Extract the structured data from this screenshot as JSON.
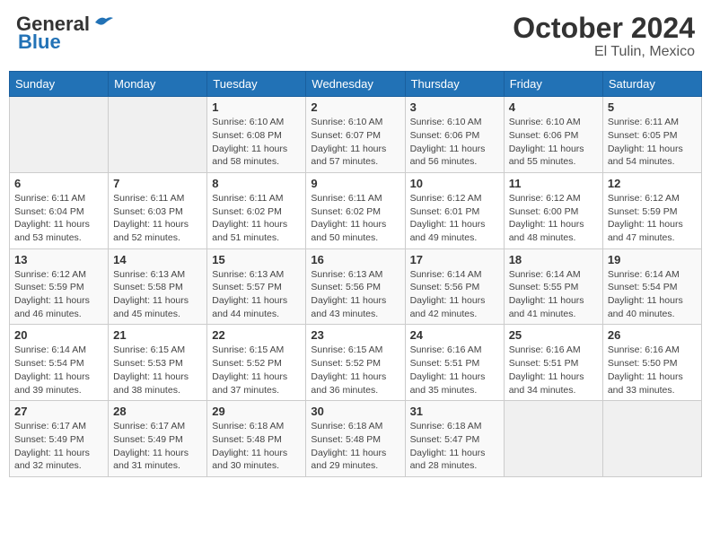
{
  "header": {
    "logo_general": "General",
    "logo_blue": "Blue",
    "month": "October 2024",
    "location": "El Tulin, Mexico"
  },
  "weekdays": [
    "Sunday",
    "Monday",
    "Tuesday",
    "Wednesday",
    "Thursday",
    "Friday",
    "Saturday"
  ],
  "weeks": [
    [
      {
        "day": "",
        "sunrise": "",
        "sunset": "",
        "daylight": ""
      },
      {
        "day": "",
        "sunrise": "",
        "sunset": "",
        "daylight": ""
      },
      {
        "day": "1",
        "sunrise": "Sunrise: 6:10 AM",
        "sunset": "Sunset: 6:08 PM",
        "daylight": "Daylight: 11 hours and 58 minutes."
      },
      {
        "day": "2",
        "sunrise": "Sunrise: 6:10 AM",
        "sunset": "Sunset: 6:07 PM",
        "daylight": "Daylight: 11 hours and 57 minutes."
      },
      {
        "day": "3",
        "sunrise": "Sunrise: 6:10 AM",
        "sunset": "Sunset: 6:06 PM",
        "daylight": "Daylight: 11 hours and 56 minutes."
      },
      {
        "day": "4",
        "sunrise": "Sunrise: 6:10 AM",
        "sunset": "Sunset: 6:06 PM",
        "daylight": "Daylight: 11 hours and 55 minutes."
      },
      {
        "day": "5",
        "sunrise": "Sunrise: 6:11 AM",
        "sunset": "Sunset: 6:05 PM",
        "daylight": "Daylight: 11 hours and 54 minutes."
      }
    ],
    [
      {
        "day": "6",
        "sunrise": "Sunrise: 6:11 AM",
        "sunset": "Sunset: 6:04 PM",
        "daylight": "Daylight: 11 hours and 53 minutes."
      },
      {
        "day": "7",
        "sunrise": "Sunrise: 6:11 AM",
        "sunset": "Sunset: 6:03 PM",
        "daylight": "Daylight: 11 hours and 52 minutes."
      },
      {
        "day": "8",
        "sunrise": "Sunrise: 6:11 AM",
        "sunset": "Sunset: 6:02 PM",
        "daylight": "Daylight: 11 hours and 51 minutes."
      },
      {
        "day": "9",
        "sunrise": "Sunrise: 6:11 AM",
        "sunset": "Sunset: 6:02 PM",
        "daylight": "Daylight: 11 hours and 50 minutes."
      },
      {
        "day": "10",
        "sunrise": "Sunrise: 6:12 AM",
        "sunset": "Sunset: 6:01 PM",
        "daylight": "Daylight: 11 hours and 49 minutes."
      },
      {
        "day": "11",
        "sunrise": "Sunrise: 6:12 AM",
        "sunset": "Sunset: 6:00 PM",
        "daylight": "Daylight: 11 hours and 48 minutes."
      },
      {
        "day": "12",
        "sunrise": "Sunrise: 6:12 AM",
        "sunset": "Sunset: 5:59 PM",
        "daylight": "Daylight: 11 hours and 47 minutes."
      }
    ],
    [
      {
        "day": "13",
        "sunrise": "Sunrise: 6:12 AM",
        "sunset": "Sunset: 5:59 PM",
        "daylight": "Daylight: 11 hours and 46 minutes."
      },
      {
        "day": "14",
        "sunrise": "Sunrise: 6:13 AM",
        "sunset": "Sunset: 5:58 PM",
        "daylight": "Daylight: 11 hours and 45 minutes."
      },
      {
        "day": "15",
        "sunrise": "Sunrise: 6:13 AM",
        "sunset": "Sunset: 5:57 PM",
        "daylight": "Daylight: 11 hours and 44 minutes."
      },
      {
        "day": "16",
        "sunrise": "Sunrise: 6:13 AM",
        "sunset": "Sunset: 5:56 PM",
        "daylight": "Daylight: 11 hours and 43 minutes."
      },
      {
        "day": "17",
        "sunrise": "Sunrise: 6:14 AM",
        "sunset": "Sunset: 5:56 PM",
        "daylight": "Daylight: 11 hours and 42 minutes."
      },
      {
        "day": "18",
        "sunrise": "Sunrise: 6:14 AM",
        "sunset": "Sunset: 5:55 PM",
        "daylight": "Daylight: 11 hours and 41 minutes."
      },
      {
        "day": "19",
        "sunrise": "Sunrise: 6:14 AM",
        "sunset": "Sunset: 5:54 PM",
        "daylight": "Daylight: 11 hours and 40 minutes."
      }
    ],
    [
      {
        "day": "20",
        "sunrise": "Sunrise: 6:14 AM",
        "sunset": "Sunset: 5:54 PM",
        "daylight": "Daylight: 11 hours and 39 minutes."
      },
      {
        "day": "21",
        "sunrise": "Sunrise: 6:15 AM",
        "sunset": "Sunset: 5:53 PM",
        "daylight": "Daylight: 11 hours and 38 minutes."
      },
      {
        "day": "22",
        "sunrise": "Sunrise: 6:15 AM",
        "sunset": "Sunset: 5:52 PM",
        "daylight": "Daylight: 11 hours and 37 minutes."
      },
      {
        "day": "23",
        "sunrise": "Sunrise: 6:15 AM",
        "sunset": "Sunset: 5:52 PM",
        "daylight": "Daylight: 11 hours and 36 minutes."
      },
      {
        "day": "24",
        "sunrise": "Sunrise: 6:16 AM",
        "sunset": "Sunset: 5:51 PM",
        "daylight": "Daylight: 11 hours and 35 minutes."
      },
      {
        "day": "25",
        "sunrise": "Sunrise: 6:16 AM",
        "sunset": "Sunset: 5:51 PM",
        "daylight": "Daylight: 11 hours and 34 minutes."
      },
      {
        "day": "26",
        "sunrise": "Sunrise: 6:16 AM",
        "sunset": "Sunset: 5:50 PM",
        "daylight": "Daylight: 11 hours and 33 minutes."
      }
    ],
    [
      {
        "day": "27",
        "sunrise": "Sunrise: 6:17 AM",
        "sunset": "Sunset: 5:49 PM",
        "daylight": "Daylight: 11 hours and 32 minutes."
      },
      {
        "day": "28",
        "sunrise": "Sunrise: 6:17 AM",
        "sunset": "Sunset: 5:49 PM",
        "daylight": "Daylight: 11 hours and 31 minutes."
      },
      {
        "day": "29",
        "sunrise": "Sunrise: 6:18 AM",
        "sunset": "Sunset: 5:48 PM",
        "daylight": "Daylight: 11 hours and 30 minutes."
      },
      {
        "day": "30",
        "sunrise": "Sunrise: 6:18 AM",
        "sunset": "Sunset: 5:48 PM",
        "daylight": "Daylight: 11 hours and 29 minutes."
      },
      {
        "day": "31",
        "sunrise": "Sunrise: 6:18 AM",
        "sunset": "Sunset: 5:47 PM",
        "daylight": "Daylight: 11 hours and 28 minutes."
      },
      {
        "day": "",
        "sunrise": "",
        "sunset": "",
        "daylight": ""
      },
      {
        "day": "",
        "sunrise": "",
        "sunset": "",
        "daylight": ""
      }
    ]
  ]
}
